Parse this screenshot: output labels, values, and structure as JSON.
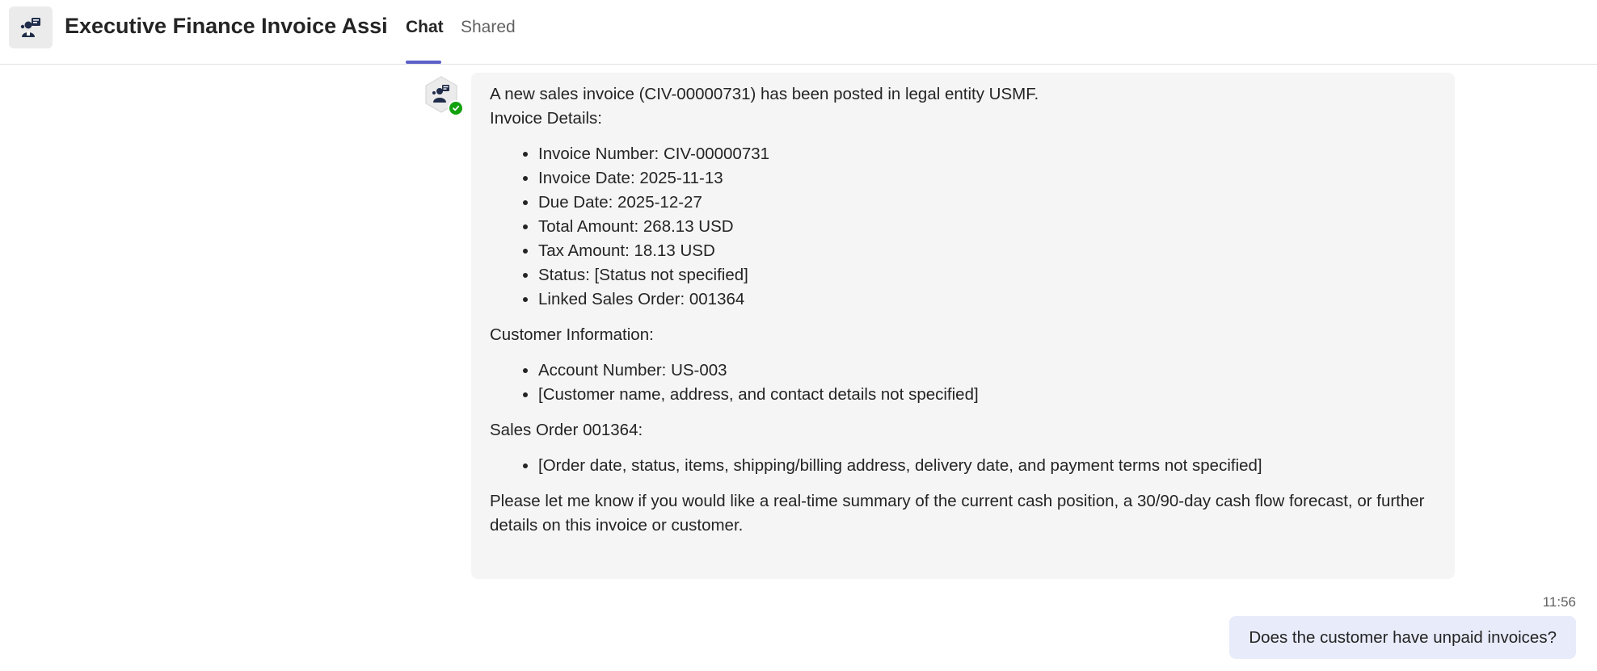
{
  "header": {
    "app_title": "Executive Finance Invoice Assi",
    "tabs": [
      {
        "label": "Chat",
        "active": true
      },
      {
        "label": "Shared",
        "active": false
      }
    ]
  },
  "bot_message": {
    "intro": "A new sales invoice (CIV-00000731) has been posted in legal entity USMF.",
    "invoice_heading": "Invoice Details:",
    "invoice_items": [
      "Invoice Number: CIV-00000731",
      "Invoice Date: 2025-11-13",
      "Due Date: 2025-12-27",
      "Total Amount: 268.13 USD",
      "Tax Amount: 18.13 USD",
      "Status: [Status not specified]",
      "Linked Sales Order: 001364"
    ],
    "customer_heading": "Customer Information:",
    "customer_items": [
      "Account Number: US-003",
      "[Customer name, address, and contact details not specified]"
    ],
    "order_heading": "Sales Order 001364:",
    "order_items": [
      "[Order date, status, items, shipping/billing address, delivery date, and payment terms not specified]"
    ],
    "closing": "Please let me know if you would like a real-time summary of the current cash position, a 30/90-day cash flow forecast, or further details on this invoice or customer."
  },
  "user_message": {
    "timestamp": "11:56",
    "text": "Does the customer have unpaid invoices?"
  },
  "colors": {
    "accent": "#5b5fc7",
    "bot_bubble": "#f5f5f5",
    "user_bubble": "#e8ebfa",
    "presence": "#13a10e"
  },
  "icons": {
    "app": "finance-bot-icon",
    "bot_avatar": "finance-bot-icon",
    "presence": "checkmark-icon"
  }
}
